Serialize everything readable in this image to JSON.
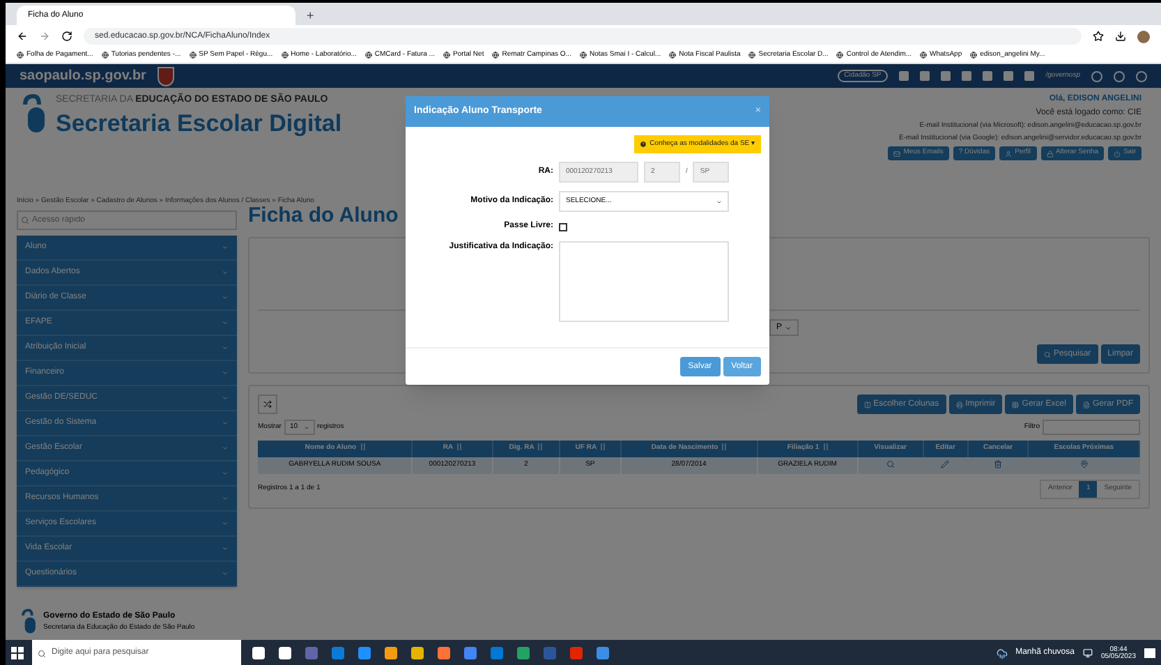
{
  "browser": {
    "tabs": [
      {
        "label": "Ficha do Aluno",
        "selected": true
      }
    ],
    "new_tab": "+",
    "url": "sed.educacao.sp.gov.br/NCA/FichaAluno/Index",
    "bookmarks": [
      "Folha de Pagament...",
      "Tutorias pendentes -...",
      "SP Sem Papel - Règu...",
      "Home - Laboratório...",
      "CMCard - Fatura ...",
      "Portal Net",
      "Rematr Campinas O...",
      "Notas Smai I - Calcul...",
      "Nota Fiscal Paulista",
      "Secretaria Escolar D...",
      "Control de Atendim...",
      "WhatsApp",
      "edison_angelini My..."
    ]
  },
  "gov_bar": {
    "site": "saopaulo.sp.gov.br",
    "citizen_button": "Cidadão SP",
    "social_handle": "/governosp"
  },
  "header": {
    "org_prefix": "SECRETARIA DA ",
    "org_bold": "EDUCAÇÃO DO ESTADO DE SÃO PAULO",
    "system": "Secretaria Escolar Digital",
    "greeting": "Olá, EDISON ANGELINI",
    "logged_as": "Você está logado como: CIE",
    "emails": [
      "E-mail Institucional (via Microsoft): edison.angelini@educacao.sp.gov.br",
      "E-mail Institucional (via Google): edison.angelini@servidor.educacao.sp.gov.br"
    ],
    "user_buttons": [
      {
        "kind": "mail",
        "label": "Meus Emails"
      },
      {
        "kind": "help",
        "label": "? Dúvidas"
      },
      {
        "kind": "user",
        "label": "Perfil"
      },
      {
        "kind": "lock",
        "label": "Alterar Senha"
      },
      {
        "kind": "power",
        "label": "Sair"
      }
    ]
  },
  "breadcrumb": "Início » Gestão Escolar » Cadastro de Alunos » Informações dos Alunos / Classes » Ficha Aluno",
  "sidebar": {
    "search_placeholder": "Acesso rápido",
    "items": [
      "Aluno",
      "Dados Abertos",
      "Diário de Classe",
      "EFAPE",
      "Atribuição Inicial",
      "Financeiro",
      "Gestão DE/SEDUC",
      "Gestão do Sistema",
      "Gestão Escolar",
      "Pedagógico",
      "Recursos Humanos",
      "Serviços Escolares",
      "Vida Escolar",
      "Questionários"
    ]
  },
  "page_title": "Ficha do Aluno",
  "filter_panel": {
    "uf_select": "P",
    "buttons": [
      {
        "kind": "search",
        "label": "Pesquisar"
      },
      {
        "kind": "plain",
        "label": "Limpar"
      }
    ]
  },
  "results": {
    "show_prefix": "Mostrar",
    "page_size": "10",
    "show_suffix": "registros",
    "export_buttons": [
      {
        "kind": "columns",
        "label": "Escolher Colunas"
      },
      {
        "kind": "print",
        "label": "Imprimir"
      },
      {
        "kind": "excel",
        "label": "Gerar Excel"
      },
      {
        "kind": "pdf",
        "label": "Gerar PDF"
      }
    ],
    "filter_label": "Filtro",
    "columns": [
      {
        "label": "Nome do Aluno",
        "sortable": true
      },
      {
        "label": "RA",
        "sortable": true
      },
      {
        "label": "Dig. RA",
        "sortable": true
      },
      {
        "label": "UF RA",
        "sortable": true
      },
      {
        "label": "Data de Nascimento",
        "sortable": true
      },
      {
        "label": "Filiação 1",
        "sortable": true
      },
      {
        "label": "Visualizar",
        "sortable": false
      },
      {
        "label": "Editar",
        "sortable": false
      },
      {
        "label": "Cancelar",
        "sortable": false
      },
      {
        "label": "Escolas Próximas",
        "sortable": false
      }
    ],
    "rows": [
      {
        "cells": [
          "GABRYELLA RUDIM SOUSA",
          "000120270213",
          "2",
          "SP",
          "28/07/2014",
          "GRAZIELA RUDIM"
        ]
      }
    ],
    "summary": "Registros 1 a 1 de 1",
    "pagination": [
      {
        "label": "Anterior",
        "selected": false
      },
      {
        "label": "1",
        "selected": true
      },
      {
        "label": "Seguinte",
        "selected": false
      }
    ]
  },
  "footer": {
    "title": "Governo do Estado de São Paulo",
    "subtitle": "Secretaria da Educação do Estado de São Paulo"
  },
  "modal": {
    "title": "Indicação Aluno Transporte",
    "close": "×",
    "info_button": "Conheça as modalidades da SE ▾",
    "ra_label": "RA:",
    "ra": "000120270213",
    "ra_digit": "2",
    "ra_sep": "/",
    "ra_uf": "SP",
    "reason_label": "Motivo da Indicação:",
    "reason_value": "SELECIONE...",
    "free_pass_label": "Passe Livre:",
    "free_pass_checked": false,
    "justification_label": "Justificativa da Indicação:",
    "buttons": [
      {
        "kind": "primary",
        "label": "Salvar"
      },
      {
        "kind": "secondary",
        "label": "Voltar"
      }
    ]
  },
  "taskbar": {
    "search_placeholder": "Digite aqui para pesquisar",
    "weather": "Manhã chuvosa",
    "time": "08:44",
    "date": "05/05/2023"
  }
}
